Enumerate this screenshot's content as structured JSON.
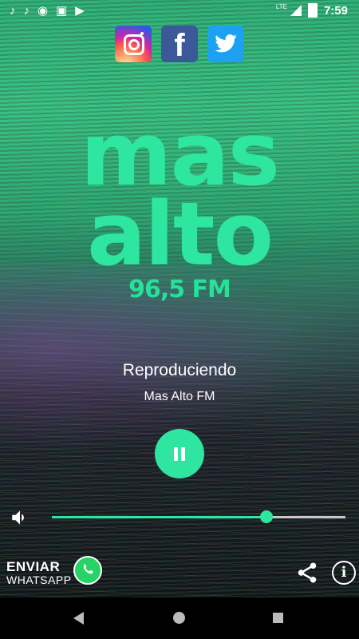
{
  "status_bar": {
    "time": "7:59",
    "network": "LTE",
    "notification_icons": [
      "music-note-icon",
      "music-note-icon",
      "circle-icon",
      "image-icon",
      "play-store-icon"
    ]
  },
  "social": {
    "instagram": "instagram-icon",
    "facebook_glyph": "f",
    "twitter": "twitter-icon"
  },
  "logo": {
    "line1": "mas",
    "line2": "alto",
    "frequency": "96,5 FM"
  },
  "now_playing": {
    "status": "Reproduciendo",
    "station": "Mas Alto FM"
  },
  "controls": {
    "play_state": "pause-icon",
    "volume_level": 0.73
  },
  "bottom_actions": {
    "whatsapp_line1": "ENVIAR",
    "whatsapp_line2": "WHATSAPP",
    "info_glyph": "i"
  },
  "colors": {
    "accent": "#2ee6a0",
    "whatsapp": "#25d366",
    "facebook": "#3b5998",
    "twitter": "#1da1f2"
  }
}
